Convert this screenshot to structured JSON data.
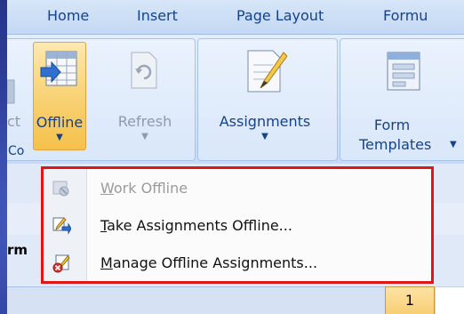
{
  "tabs": [
    "Home",
    "Insert",
    "Page Layout",
    "Formu"
  ],
  "ribbon": {
    "partial_left_label": "ct",
    "offline_label": "Offline",
    "refresh_label": "Refresh",
    "assignments_label": "Assignments",
    "form_label_line1": "Form",
    "form_label_line2": "Templates",
    "group_label_partial": "Co"
  },
  "menu": {
    "items": [
      {
        "accel": "W",
        "rest": "ork Offline",
        "enabled": false,
        "icon": "work-offline-icon"
      },
      {
        "accel": "T",
        "rest": "ake Assignments Offline...",
        "enabled": true,
        "icon": "take-offline-icon"
      },
      {
        "accel": "M",
        "rest": "anage Offline Assignments...",
        "enabled": true,
        "icon": "manage-offline-icon"
      }
    ]
  },
  "sheet": {
    "partial_label": "rm",
    "row_number": "1"
  },
  "colors": {
    "tab_text": "#15428b",
    "highlight_border": "#e01515",
    "selected_button": "#f9d47a"
  }
}
